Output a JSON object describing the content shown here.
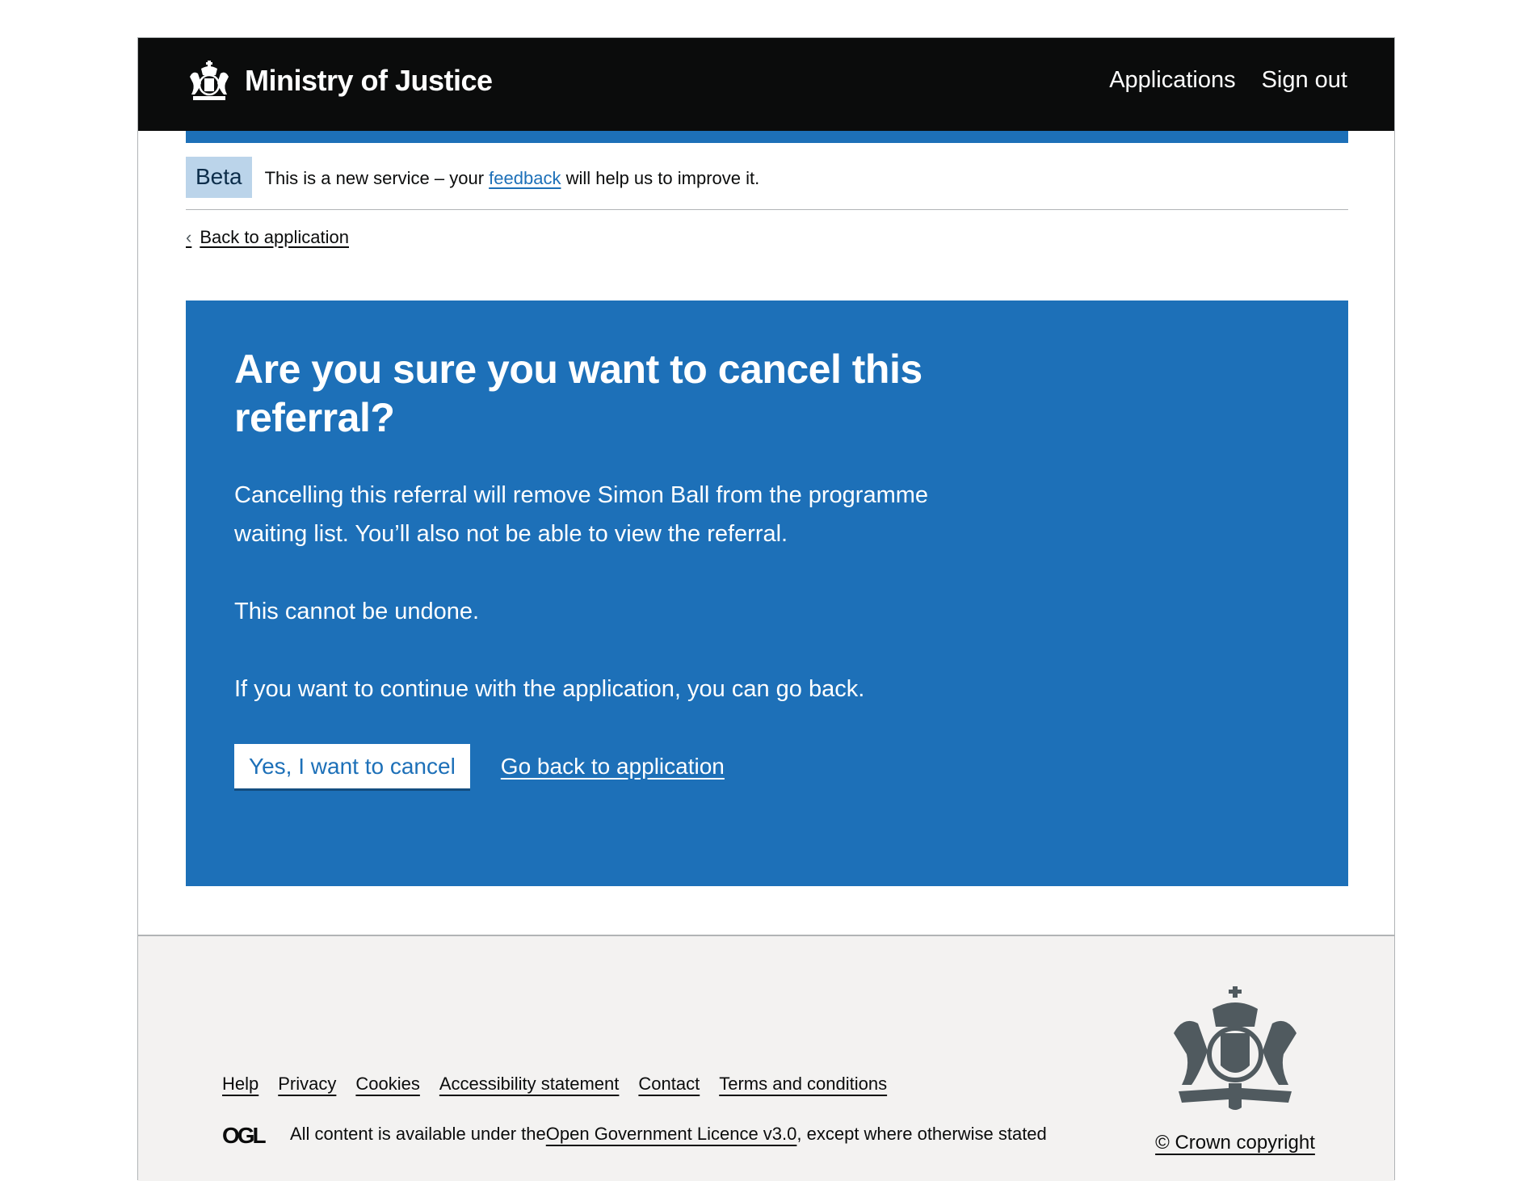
{
  "header": {
    "brand": "Ministry of Justice",
    "nav": [
      {
        "label": "Applications"
      },
      {
        "label": "Sign out"
      }
    ]
  },
  "phase_banner": {
    "tag": "Beta",
    "text_before": "This is a new service – your ",
    "link": "feedback",
    "text_after": " will help us to improve it."
  },
  "back_link": {
    "label": "Back to application"
  },
  "panel": {
    "heading": "Are you sure you want to cancel this referral?",
    "paragraphs": [
      "Cancelling this referral will remove Simon Ball from the programme waiting list. You’ll also not be able to view the referral.",
      "This cannot be undone.",
      "If you want to continue with the application, you can go back."
    ],
    "confirm_button": "Yes, I want to cancel",
    "back_link": "Go back to application"
  },
  "footer": {
    "links": [
      {
        "label": "Help"
      },
      {
        "label": "Privacy"
      },
      {
        "label": "Cookies"
      },
      {
        "label": "Accessibility statement"
      },
      {
        "label": "Contact"
      },
      {
        "label": "Terms and conditions"
      }
    ],
    "licence_before": "All content is available under the ",
    "licence_link": "Open Government Licence v3.0",
    "licence_after": ", except where otherwise stated",
    "copyright": "© Crown copyright"
  },
  "colors": {
    "header_bg": "#0b0c0c",
    "brand_blue": "#1d70b8",
    "tag_bg": "#bbd4ea",
    "footer_bg": "#f3f2f1"
  }
}
